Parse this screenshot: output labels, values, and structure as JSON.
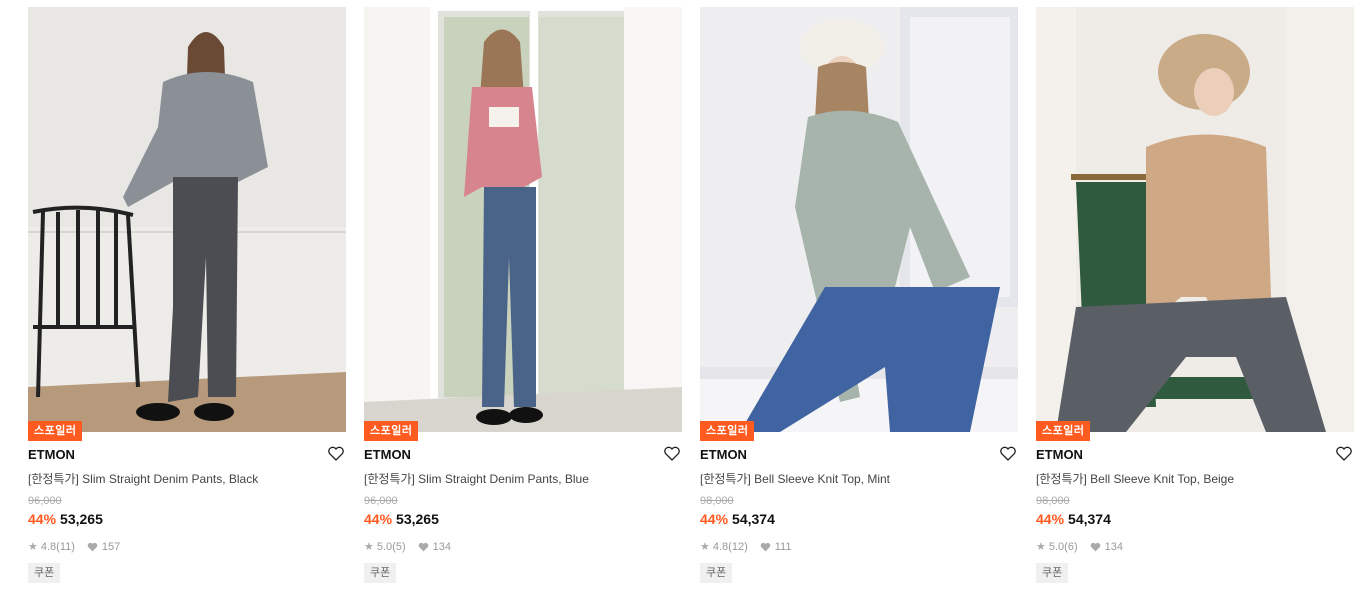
{
  "products": [
    {
      "badge": "스포일러",
      "brand": "ETMON",
      "title": "[한정특가] Slim Straight Denim Pants, Black",
      "original_price": "96,000",
      "discount": "44%",
      "price": "53,265",
      "rating": "4.8",
      "reviews": "(11)",
      "likes": "157",
      "coupon": "쿠폰"
    },
    {
      "badge": "스포일러",
      "brand": "ETMON",
      "title": "[한정특가] Slim Straight Denim Pants, Blue",
      "original_price": "96,000",
      "discount": "44%",
      "price": "53,265",
      "rating": "5.0",
      "reviews": "(5)",
      "likes": "134",
      "coupon": "쿠폰"
    },
    {
      "badge": "스포일러",
      "brand": "ETMON",
      "title": "[한정특가] Bell Sleeve Knit Top, Mint",
      "original_price": "98,000",
      "discount": "44%",
      "price": "54,374",
      "rating": "4.8",
      "reviews": "(12)",
      "likes": "111",
      "coupon": "쿠폰"
    },
    {
      "badge": "스포일러",
      "brand": "ETMON",
      "title": "[한정특가] Bell Sleeve Knit Top, Beige",
      "original_price": "98,000",
      "discount": "44%",
      "price": "54,374",
      "rating": "5.0",
      "reviews": "(6)",
      "likes": "134",
      "coupon": "쿠폰"
    }
  ],
  "colors": {
    "accent": "#ff5a1f",
    "strike": "#aaaaaa",
    "coupon_bg": "#f0f0f0"
  },
  "icons": {
    "wishlist": "heart-outline-icon",
    "rating": "star-icon",
    "likes": "heart-filled-icon"
  }
}
